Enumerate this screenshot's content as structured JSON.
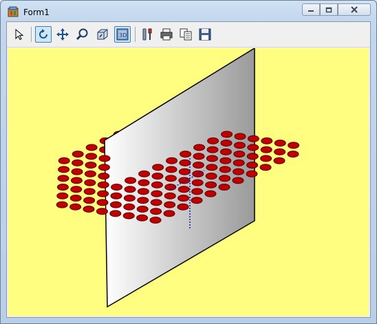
{
  "window": {
    "title": "Form1"
  },
  "toolbar": {
    "tools": [
      {
        "name": "select-tool",
        "icon": "arrow-cursor-icon",
        "active": false
      },
      {
        "name": "rotate-tool",
        "icon": "rotate-icon",
        "active": true
      },
      {
        "name": "pan-tool",
        "icon": "move-arrows-icon",
        "active": false
      },
      {
        "name": "zoom-tool",
        "icon": "magnifier-icon",
        "active": false
      },
      {
        "name": "3d-depth-tool",
        "icon": "box-3d-icon",
        "active": false
      },
      {
        "name": "3d-view-tool",
        "icon": "view-3d-icon",
        "active": true
      },
      {
        "name": "edit-tool",
        "icon": "tools-icon",
        "active": false
      },
      {
        "name": "print-tool",
        "icon": "printer-icon",
        "active": false
      },
      {
        "name": "copy-tool",
        "icon": "copy-icon",
        "active": false
      },
      {
        "name": "save-tool",
        "icon": "floppy-disk-icon",
        "active": false
      }
    ]
  },
  "plot": {
    "background_color": "#fffe80",
    "marker_color": "#c00000",
    "highlight_marker_color": "#f4b6b6",
    "plane_gradient": [
      "#ffffff",
      "#9a9a9a"
    ]
  }
}
